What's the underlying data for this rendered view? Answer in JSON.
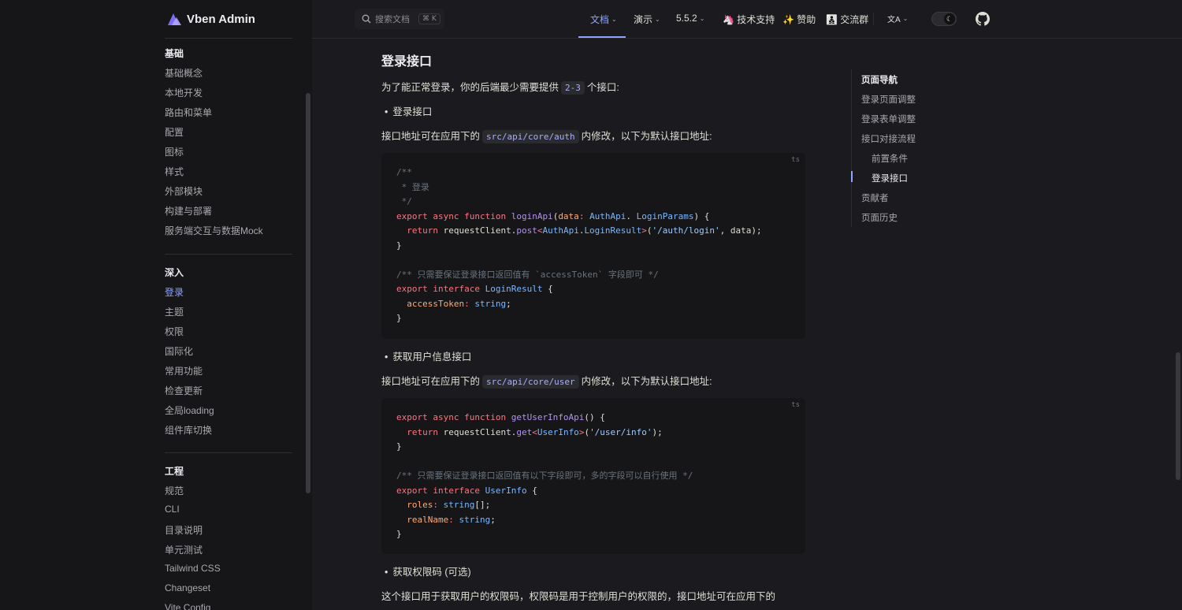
{
  "app": {
    "name": "Vben Admin"
  },
  "sidebar": {
    "groups": [
      {
        "title": "基础",
        "items": [
          "基础概念",
          "本地开发",
          "路由和菜单",
          "配置",
          "图标",
          "样式",
          "外部模块",
          "构建与部署",
          "服务端交互与数据Mock"
        ]
      },
      {
        "title": "深入",
        "items": [
          "登录",
          "主题",
          "权限",
          "国际化",
          "常用功能",
          "检查更新",
          "全局loading",
          "组件库切换"
        ],
        "active": "登录"
      },
      {
        "title": "工程",
        "items": [
          "规范",
          "CLI",
          "目录说明",
          "单元测试",
          "Tailwind CSS",
          "Changeset",
          "Vite Config"
        ]
      }
    ]
  },
  "header": {
    "search_placeholder": "搜索文档",
    "search_shortcut": "⌘ K",
    "nav": [
      {
        "label": "文档",
        "dropdown": true,
        "active": true
      },
      {
        "label": "演示",
        "dropdown": true
      },
      {
        "label": "5.5.2",
        "dropdown": true
      },
      {
        "label": "🦄 技术支持"
      },
      {
        "label": "✨ 赞助"
      },
      {
        "label": "👨‍👦‍👦 交流群"
      }
    ],
    "lang_icon": "文A"
  },
  "content": {
    "heading": "登录接口",
    "intro_prefix": "为了能正常登录，你的后端最少需要提供",
    "intro_code": "2-3",
    "intro_suffix": "个接口:",
    "bullet1": "登录接口",
    "path1_prefix": "接口地址可在应用下的",
    "path1_code": "src/api/core/auth",
    "path1_suffix": "内修改，以下为默认接口地址:",
    "code1_lang": "ts",
    "bullet2": "获取用户信息接口",
    "path2_prefix": "接口地址可在应用下的",
    "path2_code": "src/api/core/user",
    "path2_suffix": "内修改，以下为默认接口地址:",
    "code2_lang": "ts",
    "bullet3": "获取权限码 (可选)",
    "para3": "这个接口用于获取用户的权限码，权限码是用于控制用户的权限的，接口地址可在应用下的"
  },
  "code1": [
    [
      [
        "cm",
        "/**"
      ]
    ],
    [
      [
        "cm",
        " * 登录"
      ]
    ],
    [
      [
        "cm",
        " */"
      ]
    ],
    [
      [
        "kw",
        "export async function "
      ],
      [
        "fn",
        "loginApi"
      ],
      [
        "",
        "("
      ],
      [
        "pr",
        "data"
      ],
      [
        "kw",
        ": "
      ],
      [
        "ty",
        "AuthApi"
      ],
      [
        "",
        ". "
      ],
      [
        "ty",
        "LoginParams"
      ],
      [
        "",
        ") {"
      ]
    ],
    [
      [
        "kw",
        "  return "
      ],
      [
        "",
        "requestClient."
      ],
      [
        "fn",
        "post"
      ],
      [
        "kw",
        "<"
      ],
      [
        "ty",
        "AuthApi"
      ],
      [
        "",
        "."
      ],
      [
        "ty",
        "LoginResult"
      ],
      [
        "kw",
        ">"
      ],
      [
        "",
        "("
      ],
      [
        "st",
        "'/auth/login'"
      ],
      [
        "",
        ", data);"
      ]
    ],
    [
      [
        "",
        "}"
      ]
    ],
    [
      [
        "",
        ""
      ]
    ],
    [
      [
        "cm",
        "/** 只需要保证登录接口返回值有 `accessToken` 字段即可 */"
      ]
    ],
    [
      [
        "kw",
        "export interface "
      ],
      [
        "ty",
        "LoginResult"
      ],
      [
        "",
        " {"
      ]
    ],
    [
      [
        "pr",
        "  accessToken"
      ],
      [
        "kw",
        ": "
      ],
      [
        "ty",
        "string"
      ],
      [
        "",
        ";"
      ]
    ],
    [
      [
        "",
        "}"
      ]
    ]
  ],
  "code2": [
    [
      [
        "kw",
        "export async function "
      ],
      [
        "fn",
        "getUserInfoApi"
      ],
      [
        "",
        "() {"
      ]
    ],
    [
      [
        "kw",
        "  return "
      ],
      [
        "",
        "requestClient."
      ],
      [
        "fn",
        "get"
      ],
      [
        "kw",
        "<"
      ],
      [
        "ty",
        "UserInfo"
      ],
      [
        "kw",
        ">"
      ],
      [
        "",
        "("
      ],
      [
        "st",
        "'/user/info'"
      ],
      [
        "",
        ");"
      ]
    ],
    [
      [
        "",
        "}"
      ]
    ],
    [
      [
        "",
        ""
      ]
    ],
    [
      [
        "cm",
        "/** 只需要保证登录接口返回值有以下字段即可，多的字段可以自行使用 */"
      ]
    ],
    [
      [
        "kw",
        "export interface "
      ],
      [
        "ty",
        "UserInfo"
      ],
      [
        "",
        " {"
      ]
    ],
    [
      [
        "pr",
        "  roles"
      ],
      [
        "kw",
        ": "
      ],
      [
        "ty",
        "string"
      ],
      [
        "",
        "[];"
      ]
    ],
    [
      [
        "pr",
        "  realName"
      ],
      [
        "kw",
        ": "
      ],
      [
        "ty",
        "string"
      ],
      [
        "",
        ";"
      ]
    ],
    [
      [
        "",
        "}"
      ]
    ]
  ],
  "toc": {
    "title": "页面导航",
    "items": [
      {
        "label": "登录页面调整",
        "level": 1
      },
      {
        "label": "登录表单调整",
        "level": 1
      },
      {
        "label": "接口对接流程",
        "level": 1
      },
      {
        "label": "前置条件",
        "level": 2
      },
      {
        "label": "登录接口",
        "level": 2,
        "active": true
      },
      {
        "label": "贡献者",
        "level": 1
      },
      {
        "label": "页面历史",
        "level": 1
      }
    ]
  },
  "colors": {
    "accent": "#8fa3ff",
    "bg": "#1b1b1f",
    "sidebar": "#161618"
  }
}
